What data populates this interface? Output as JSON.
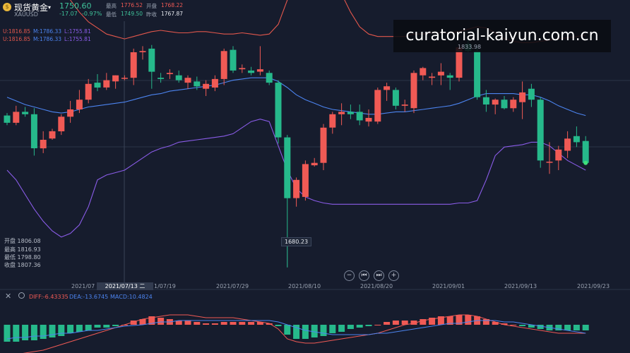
{
  "header": {
    "name": "现货黄金",
    "symbol": "XAUUSD",
    "price": "1750.60",
    "change": "-17.07",
    "change_pct": "-0.97%",
    "high_label": "最高",
    "high": "1776.52",
    "open_label": "开盘",
    "open": "1768.22",
    "low_label": "最低",
    "low": "1749.50",
    "prev_label": "昨收",
    "prev": "1767.87"
  },
  "boll": {
    "u1": "U:1816.85",
    "m1": "M:1786.33",
    "l1": "L:1755.81",
    "u2": "U:1816.85",
    "m2": "M:1786.33",
    "l2": "L:1755.81"
  },
  "watermark": "curatorial-kaiyun.com.cn",
  "ohlc_box": {
    "open": "开盘 1806.08",
    "high": "最高 1816.93",
    "low": "最低 1798.80",
    "close": "收盘 1807.36"
  },
  "markers": {
    "low": "1680.23",
    "high": "1833.98"
  },
  "dates": {
    "d0": "2021/07",
    "selected": "2021/07/13 二",
    "d1": "1/07/19",
    "d2": "2021/07/29",
    "d3": "2021/08/10",
    "d4": "2021/08/20",
    "d5": "2021/09/01",
    "d6": "2021/09/13",
    "d7": "2021/09/23"
  },
  "macd": {
    "diff": "DIFF:-6.43335",
    "dea": "DEA:-13.6745",
    "macd": "MACD:10.4824"
  },
  "controls": {
    "zoom_out": "−",
    "prev": "⏮",
    "next": "⏭",
    "zoom_in": "+"
  },
  "colors": {
    "up": "#f05a55",
    "down": "#26b98b",
    "upper_band": "#e2574c",
    "mid_band": "#4c84f0",
    "lower_band": "#8a5ce8",
    "bg": "#161c2d"
  },
  "chart_data": {
    "type": "candlestick",
    "title": "现货黄金 XAUUSD",
    "ylim": [
      1670,
      1900
    ],
    "candles": [
      {
        "o": 1805,
        "h": 1807,
        "l": 1797,
        "c": 1799
      },
      {
        "o": 1799,
        "h": 1813,
        "l": 1797,
        "c": 1808
      },
      {
        "o": 1808,
        "h": 1812,
        "l": 1804,
        "c": 1806
      },
      {
        "o": 1806,
        "h": 1811,
        "l": 1772,
        "c": 1778
      },
      {
        "o": 1778,
        "h": 1792,
        "l": 1774,
        "c": 1785
      },
      {
        "o": 1786,
        "h": 1794,
        "l": 1785,
        "c": 1792
      },
      {
        "o": 1792,
        "h": 1806,
        "l": 1789,
        "c": 1804
      },
      {
        "o": 1804,
        "h": 1817,
        "l": 1799,
        "c": 1810
      },
      {
        "o": 1810,
        "h": 1826,
        "l": 1807,
        "c": 1818
      },
      {
        "o": 1818,
        "h": 1835,
        "l": 1815,
        "c": 1831
      },
      {
        "o": 1832,
        "h": 1839,
        "l": 1825,
        "c": 1828
      },
      {
        "o": 1828,
        "h": 1840,
        "l": 1826,
        "c": 1834
      },
      {
        "o": 1833,
        "h": 1838,
        "l": 1827,
        "c": 1838
      },
      {
        "o": 1836,
        "h": 1838,
        "l": 1834,
        "c": 1836
      },
      {
        "o": 1836,
        "h": 1860,
        "l": 1830,
        "c": 1857
      },
      {
        "o": 1857,
        "h": 1862,
        "l": 1851,
        "c": 1858
      },
      {
        "o": 1860,
        "h": 1863,
        "l": 1827,
        "c": 1841
      },
      {
        "o": 1836,
        "h": 1840,
        "l": 1832,
        "c": 1835
      },
      {
        "o": 1839,
        "h": 1843,
        "l": 1835,
        "c": 1840
      },
      {
        "o": 1838,
        "h": 1842,
        "l": 1832,
        "c": 1834
      },
      {
        "o": 1832,
        "h": 1838,
        "l": 1827,
        "c": 1836
      },
      {
        "o": 1833,
        "h": 1837,
        "l": 1826,
        "c": 1829
      },
      {
        "o": 1827,
        "h": 1834,
        "l": 1821,
        "c": 1831
      },
      {
        "o": 1828,
        "h": 1838,
        "l": 1825,
        "c": 1835
      },
      {
        "o": 1835,
        "h": 1860,
        "l": 1830,
        "c": 1858
      },
      {
        "o": 1859,
        "h": 1862,
        "l": 1840,
        "c": 1842
      },
      {
        "o": 1843,
        "h": 1847,
        "l": 1840,
        "c": 1844
      },
      {
        "o": 1842,
        "h": 1845,
        "l": 1838,
        "c": 1840
      },
      {
        "o": 1841,
        "h": 1862,
        "l": 1838,
        "c": 1843
      },
      {
        "o": 1840,
        "h": 1842,
        "l": 1830,
        "c": 1832
      },
      {
        "o": 1832,
        "h": 1834,
        "l": 1782,
        "c": 1787
      },
      {
        "o": 1787,
        "h": 1789,
        "l": 1680,
        "c": 1737
      },
      {
        "o": 1737,
        "h": 1754,
        "l": 1730,
        "c": 1752
      },
      {
        "o": 1738,
        "h": 1768,
        "l": 1735,
        "c": 1765
      },
      {
        "o": 1764,
        "h": 1770,
        "l": 1763,
        "c": 1766
      },
      {
        "o": 1766,
        "h": 1798,
        "l": 1760,
        "c": 1795
      },
      {
        "o": 1795,
        "h": 1808,
        "l": 1790,
        "c": 1806
      },
      {
        "o": 1806,
        "h": 1815,
        "l": 1797,
        "c": 1808
      },
      {
        "o": 1808,
        "h": 1814,
        "l": 1802,
        "c": 1806
      },
      {
        "o": 1808,
        "h": 1814,
        "l": 1797,
        "c": 1801
      },
      {
        "o": 1800,
        "h": 1810,
        "l": 1796,
        "c": 1803
      },
      {
        "o": 1800,
        "h": 1828,
        "l": 1798,
        "c": 1826
      },
      {
        "o": 1826,
        "h": 1832,
        "l": 1817,
        "c": 1829
      },
      {
        "o": 1826,
        "h": 1828,
        "l": 1810,
        "c": 1813
      },
      {
        "o": 1813,
        "h": 1818,
        "l": 1808,
        "c": 1814
      },
      {
        "o": 1811,
        "h": 1842,
        "l": 1807,
        "c": 1840
      },
      {
        "o": 1838,
        "h": 1845,
        "l": 1834,
        "c": 1844
      },
      {
        "o": 1836,
        "h": 1840,
        "l": 1830,
        "c": 1837
      },
      {
        "o": 1838,
        "h": 1848,
        "l": 1830,
        "c": 1841
      },
      {
        "o": 1838,
        "h": 1840,
        "l": 1826,
        "c": 1836
      },
      {
        "o": 1836,
        "h": 1863,
        "l": 1833,
        "c": 1861
      },
      {
        "o": 1864,
        "h": 1870,
        "l": 1857,
        "c": 1858
      },
      {
        "o": 1858,
        "h": 1862,
        "l": 1818,
        "c": 1820
      },
      {
        "o": 1820,
        "h": 1826,
        "l": 1808,
        "c": 1814
      },
      {
        "o": 1814,
        "h": 1819,
        "l": 1806,
        "c": 1818
      },
      {
        "o": 1818,
        "h": 1821,
        "l": 1810,
        "c": 1811
      },
      {
        "o": 1811,
        "h": 1820,
        "l": 1808,
        "c": 1818
      },
      {
        "o": 1816,
        "h": 1833,
        "l": 1802,
        "c": 1824
      },
      {
        "o": 1827,
        "h": 1831,
        "l": 1812,
        "c": 1818
      },
      {
        "o": 1818,
        "h": 1820,
        "l": 1762,
        "c": 1768
      },
      {
        "o": 1767,
        "h": 1783,
        "l": 1757,
        "c": 1767
      },
      {
        "o": 1768,
        "h": 1780,
        "l": 1760,
        "c": 1777
      },
      {
        "o": 1776,
        "h": 1792,
        "l": 1770,
        "c": 1786
      },
      {
        "o": 1788,
        "h": 1796,
        "l": 1779,
        "c": 1783
      },
      {
        "o": 1784,
        "h": 1788,
        "l": 1765,
        "c": 1766
      }
    ],
    "upper_band": [
      1990,
      1975,
      1960,
      1945,
      1935,
      1925,
      1912,
      1900,
      1890,
      1882,
      1877,
      1872,
      1870,
      1868,
      1870,
      1872,
      1874,
      1875,
      1874,
      1873,
      1873,
      1874,
      1874,
      1873,
      1872,
      1872,
      1873,
      1872,
      1871,
      1872,
      1880,
      1900,
      1910,
      1918,
      1922,
      1920,
      1915,
      1905,
      1890,
      1878,
      1872,
      1870,
      1870,
      1870,
      1870,
      1872,
      1872,
      1873,
      1873,
      1873,
      1874,
      1876,
      1878,
      1877,
      1873,
      1868,
      1866,
      1865,
      1865,
      1866,
      1867,
      1868,
      1869,
      1870,
      1871
    ],
    "middle_band": [
      1820,
      1817,
      1814,
      1812,
      1810,
      1808,
      1807,
      1808,
      1810,
      1812,
      1813,
      1814,
      1815,
      1816,
      1818,
      1820,
      1822,
      1823,
      1825,
      1826,
      1827,
      1828,
      1829,
      1830,
      1832,
      1834,
      1835,
      1836,
      1836,
      1836,
      1833,
      1828,
      1822,
      1818,
      1815,
      1812,
      1810,
      1809,
      1808,
      1807,
      1806,
      1806,
      1807,
      1808,
      1808,
      1809,
      1810,
      1811,
      1812,
      1813,
      1815,
      1818,
      1821,
      1823,
      1823,
      1823,
      1823,
      1822,
      1822,
      1820,
      1817,
      1813,
      1810,
      1807,
      1805
    ],
    "lower_band": [
      1760,
      1752,
      1740,
      1728,
      1718,
      1710,
      1705,
      1708,
      1715,
      1730,
      1752,
      1756,
      1758,
      1760,
      1765,
      1770,
      1775,
      1778,
      1780,
      1783,
      1784,
      1785,
      1786,
      1787,
      1788,
      1790,
      1795,
      1800,
      1802,
      1800,
      1780,
      1760,
      1745,
      1738,
      1735,
      1733,
      1732,
      1732,
      1732,
      1732,
      1732,
      1732,
      1732,
      1732,
      1732,
      1732,
      1732,
      1732,
      1732,
      1732,
      1733,
      1733,
      1735,
      1752,
      1772,
      1779,
      1780,
      1781,
      1783,
      1783,
      1780,
      1774,
      1768,
      1764,
      1760
    ],
    "macd_histogram": [
      -12,
      -12,
      -11,
      -11,
      -10,
      -9,
      -8,
      -6,
      -5,
      -4,
      -2,
      -2,
      -1,
      0,
      3,
      4,
      6,
      5,
      4,
      3,
      3,
      2,
      1,
      1,
      2,
      2,
      2,
      2,
      2,
      1,
      -1,
      -7,
      -10,
      -10,
      -9,
      -8,
      -6,
      -5,
      -3,
      -2,
      -1,
      0,
      2,
      3,
      3,
      3,
      4,
      5,
      6,
      6,
      7,
      7,
      6,
      4,
      2,
      1,
      0,
      -1,
      -2,
      -3,
      -4,
      -4,
      -4,
      -4,
      -4
    ],
    "diff_line": [
      -22,
      -21,
      -20,
      -19,
      -18,
      -16,
      -14,
      -12,
      -10,
      -8,
      -6,
      -4,
      -2,
      0,
      2,
      4,
      5,
      6,
      7,
      7,
      7,
      6,
      5,
      5,
      5,
      5,
      4,
      3,
      2,
      1,
      -3,
      -10,
      -12,
      -13,
      -13,
      -12,
      -11,
      -10,
      -9,
      -8,
      -7,
      -6,
      -4,
      -2,
      0,
      1,
      3,
      4,
      5,
      6,
      7,
      7,
      6,
      4,
      2,
      0,
      -1,
      -2,
      -3,
      -4,
      -5,
      -6,
      -6,
      -6,
      -6
    ],
    "dea_line": [
      -10,
      -9,
      -9,
      -8,
      -8,
      -7,
      -6,
      -6,
      -5,
      -4,
      -4,
      -3,
      -2,
      -1,
      -0.5,
      0,
      1,
      2,
      2,
      3,
      3,
      3,
      3,
      3,
      3,
      3,
      3,
      3,
      3,
      3,
      2,
      0,
      -2,
      -4,
      -5,
      -6,
      -7,
      -7,
      -7,
      -7,
      -7,
      -6,
      -6,
      -5,
      -4,
      -3,
      -2,
      -1,
      0,
      1,
      1,
      2,
      3,
      3,
      3,
      2,
      2,
      1,
      0,
      -1,
      -2,
      -3,
      -4,
      -5,
      -6
    ]
  }
}
